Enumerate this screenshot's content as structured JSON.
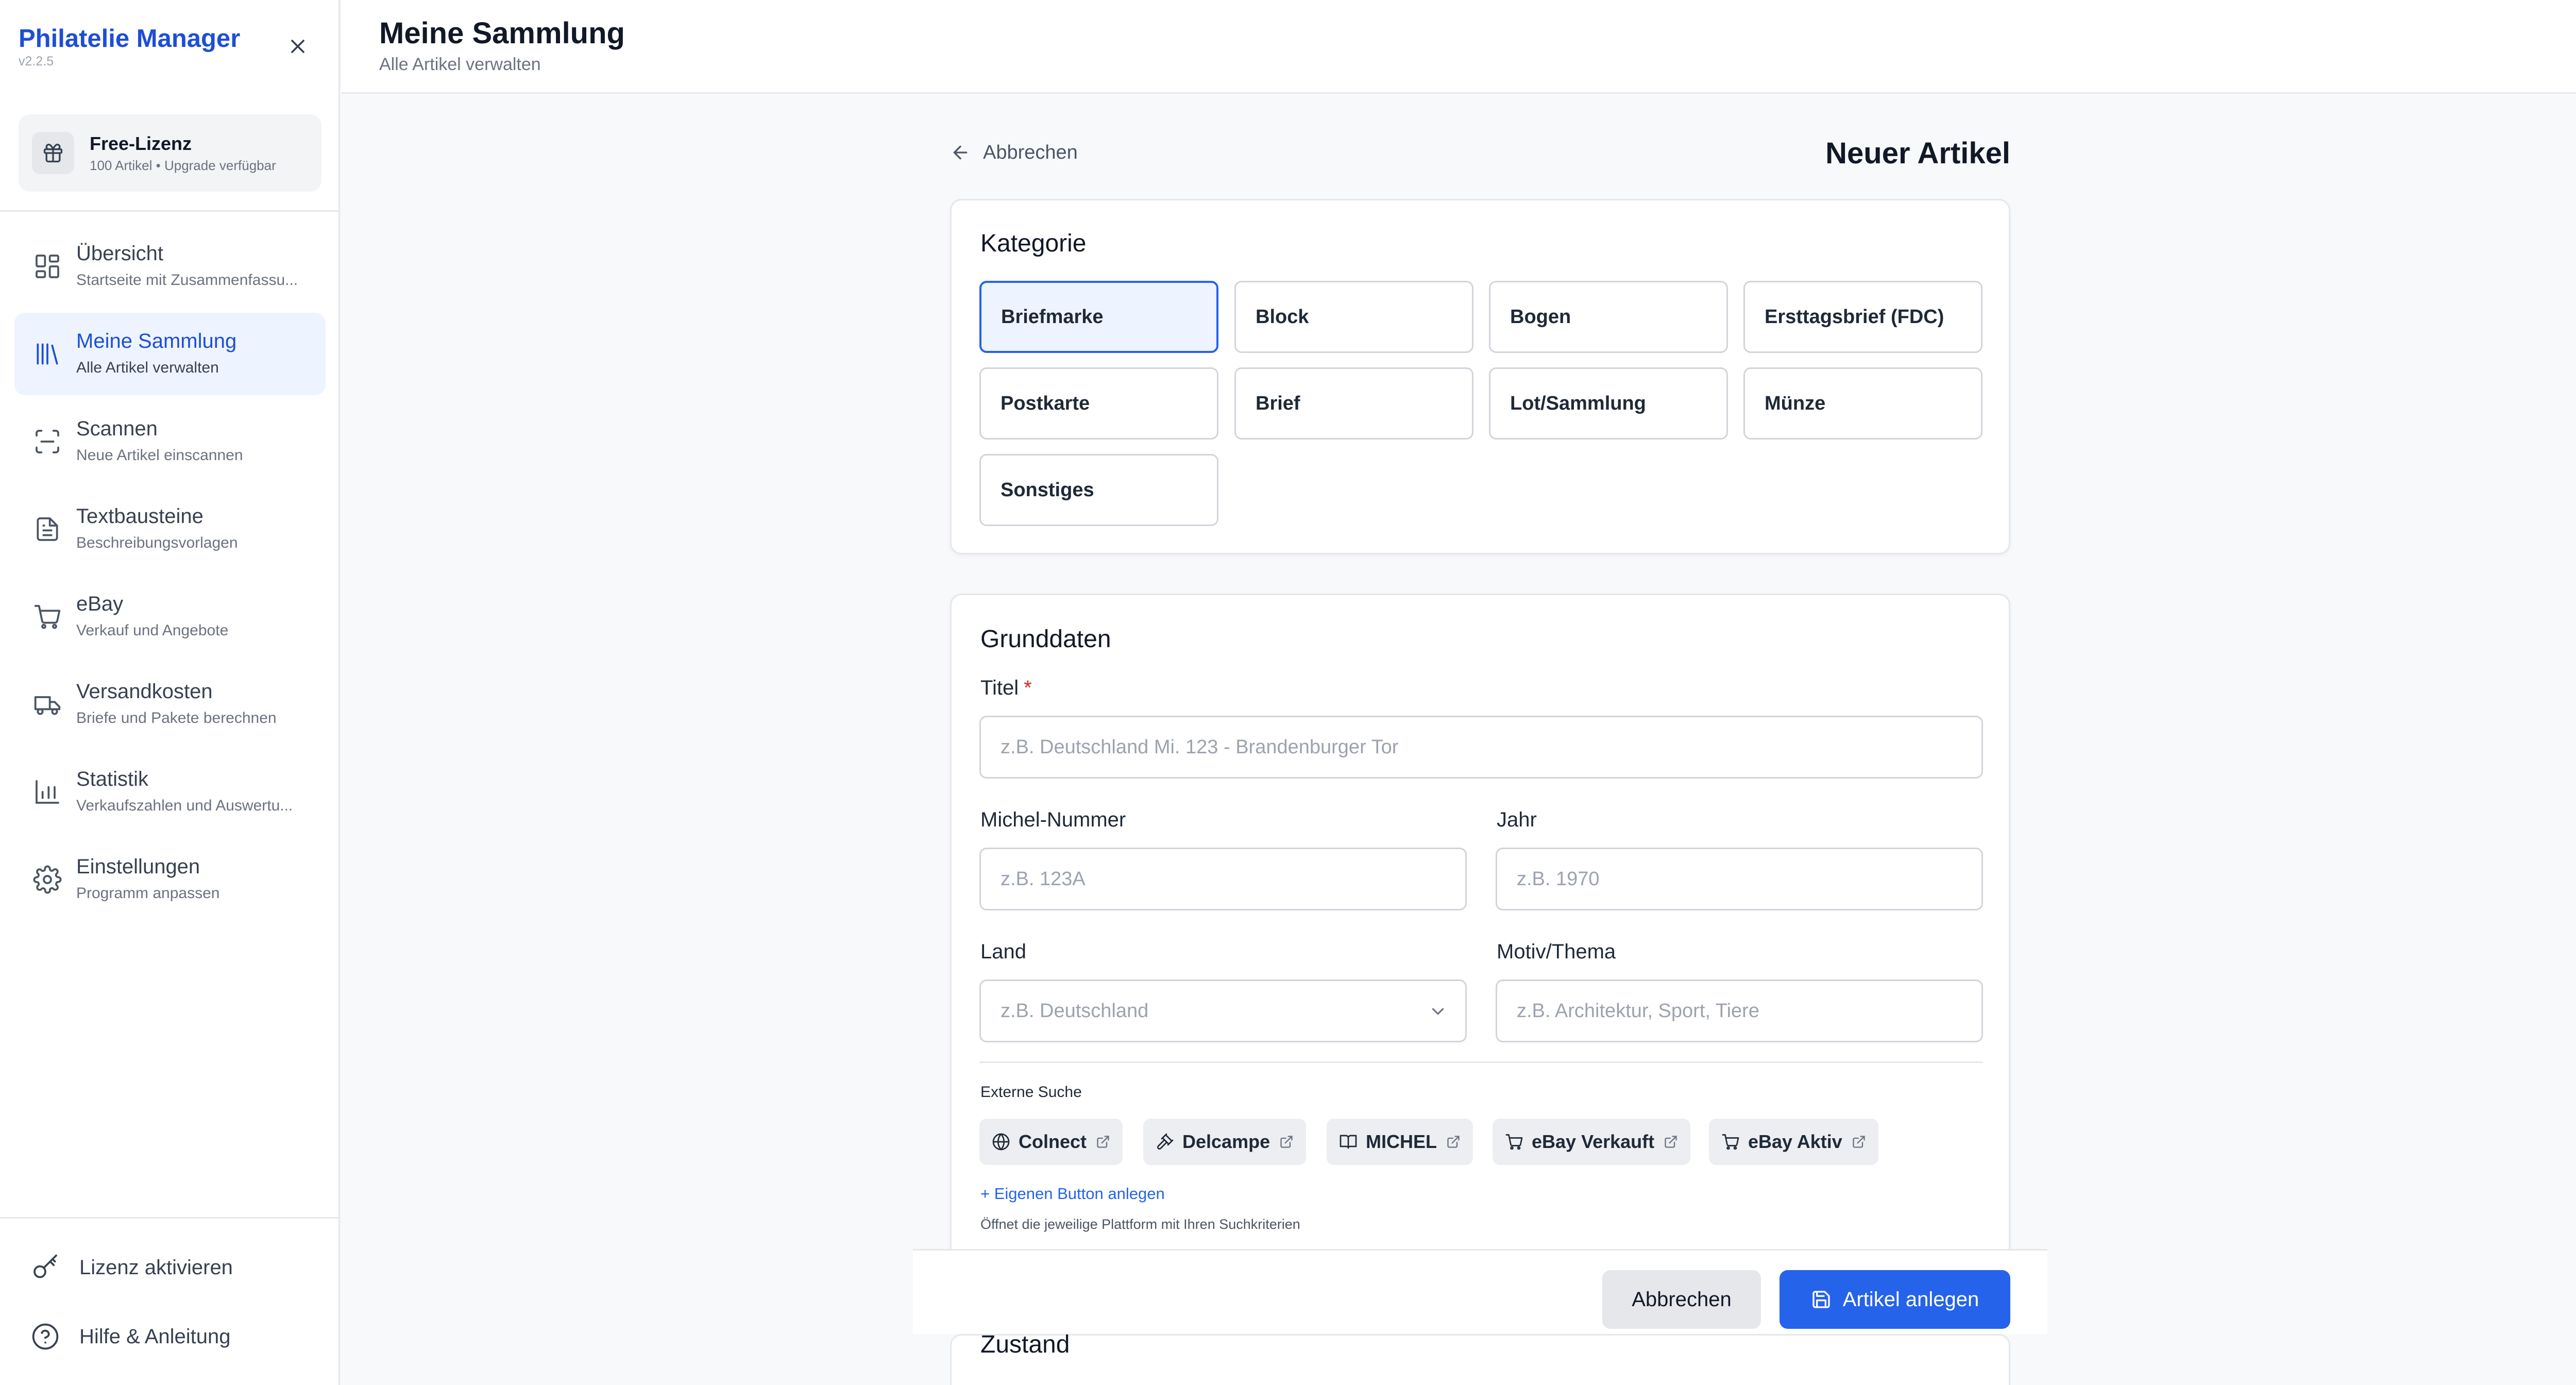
{
  "app": {
    "name": "Philatelie Manager",
    "version": "v2.2.5"
  },
  "license": {
    "title": "Free-Lizenz",
    "subtitle": "100 Artikel • Upgrade verfügbar"
  },
  "sidebar": {
    "items": [
      {
        "label": "Übersicht",
        "sub": "Startseite mit Zusammenfassu...",
        "icon": "dashboard-grid-icon",
        "active": false
      },
      {
        "label": "Meine Sammlung",
        "sub": "Alle Artikel verwalten",
        "icon": "library-icon",
        "active": true
      },
      {
        "label": "Scannen",
        "sub": "Neue Artikel einscannen",
        "icon": "scan-icon",
        "active": false
      },
      {
        "label": "Textbausteine",
        "sub": "Beschreibungsvorlagen",
        "icon": "document-icon",
        "active": false
      },
      {
        "label": "eBay",
        "sub": "Verkauf und Angebote",
        "icon": "cart-icon",
        "active": false
      },
      {
        "label": "Versandkosten",
        "sub": "Briefe und Pakete berechnen",
        "icon": "truck-icon",
        "active": false
      },
      {
        "label": "Statistik",
        "sub": "Verkaufszahlen und Auswertu...",
        "icon": "bar-chart-icon",
        "active": false
      },
      {
        "label": "Einstellungen",
        "sub": "Programm anpassen",
        "icon": "gear-icon",
        "active": false
      }
    ],
    "bottom": {
      "activate": "Lizenz aktivieren",
      "help": "Hilfe & Anleitung"
    }
  },
  "header": {
    "title": "Meine Sammlung",
    "subtitle": "Alle Artikel verwalten"
  },
  "page": {
    "back_label": "Abbrechen",
    "heading": "Neuer Artikel"
  },
  "category": {
    "title": "Kategorie",
    "options": [
      "Briefmarke",
      "Block",
      "Bogen",
      "Ersttagsbrief (FDC)",
      "Postkarte",
      "Brief",
      "Lot/Sammlung",
      "Münze",
      "Sonstiges"
    ],
    "selected": "Briefmarke"
  },
  "basics": {
    "title": "Grunddaten",
    "title_field": {
      "label": "Titel",
      "required_mark": "*",
      "placeholder": "z.B. Deutschland Mi. 123 - Brandenburger Tor"
    },
    "michel": {
      "label": "Michel-Nummer",
      "placeholder": "z.B. 123A"
    },
    "year": {
      "label": "Jahr",
      "placeholder": "z.B. 1970"
    },
    "country": {
      "label": "Land",
      "placeholder": "z.B. Deutschland"
    },
    "motif": {
      "label": "Motiv/Thema",
      "placeholder": "z.B. Architektur, Sport, Tiere"
    }
  },
  "external": {
    "label": "Externe Suche",
    "buttons": [
      {
        "label": "Colnect",
        "icon": "globe-icon"
      },
      {
        "label": "Delcampe",
        "icon": "gavel-icon"
      },
      {
        "label": "MICHEL",
        "icon": "book-icon"
      },
      {
        "label": "eBay Verkauft",
        "icon": "cart-icon"
      },
      {
        "label": "eBay Aktiv",
        "icon": "cart-icon"
      }
    ],
    "add_custom": "Eigenen Button anlegen",
    "hint": "Öffnet die jeweilige Plattform mit Ihren Suchkriterien"
  },
  "footer": {
    "cancel": "Abbrechen",
    "create": "Artikel anlegen"
  },
  "next_section": {
    "title": "Zustand"
  },
  "colors": {
    "accent": "#2563eb",
    "brand": "#1d4ed8",
    "active_bg": "#eef4ff",
    "required": "#dc2626"
  }
}
